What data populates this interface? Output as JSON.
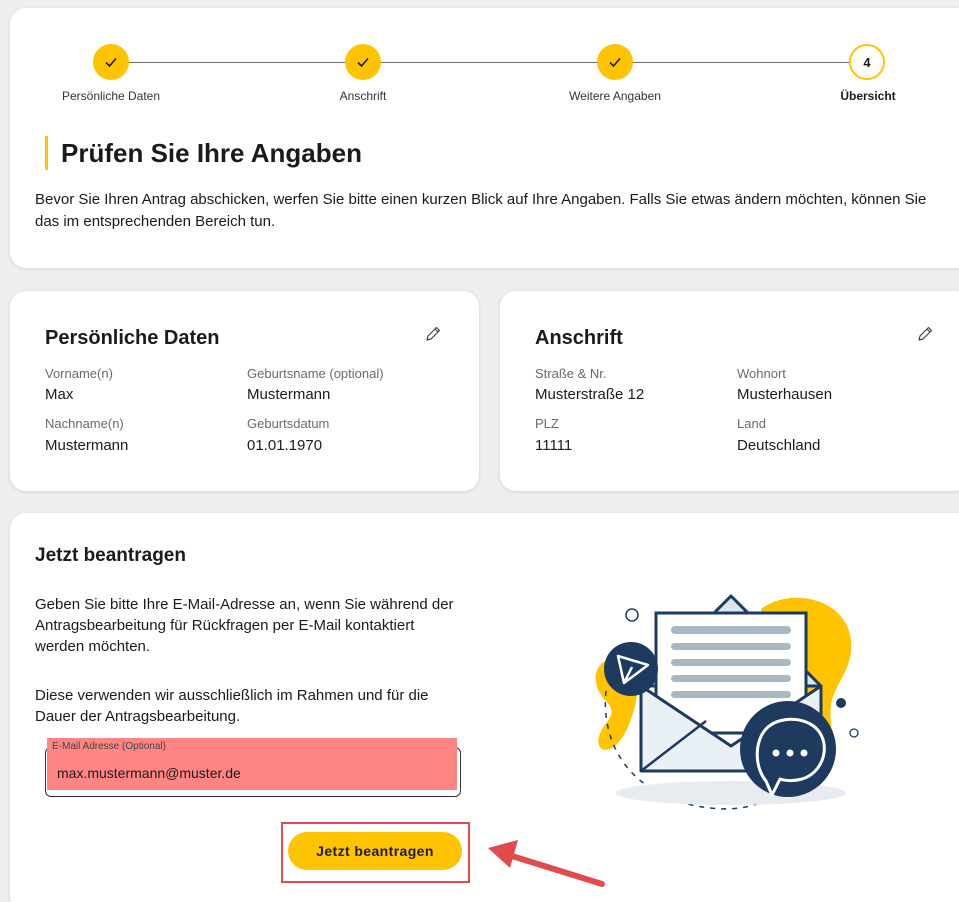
{
  "stepper": {
    "steps": [
      {
        "label": "Persönliche Daten",
        "status": "done"
      },
      {
        "label": "Anschrift",
        "status": "done"
      },
      {
        "label": "Weitere Angaben",
        "status": "done"
      },
      {
        "label": "Übersicht",
        "status": "active",
        "number": "4"
      }
    ]
  },
  "header": {
    "title": "Prüfen Sie Ihre Angaben",
    "intro": "Bevor Sie Ihren Antrag abschicken, werfen Sie bitte einen kurzen Blick auf Ihre Angaben. Falls Sie etwas ändern möchten, können Sie das im entsprechenden Bereich tun."
  },
  "personal": {
    "title": "Persönliche Daten",
    "fields": {
      "vorname": {
        "label": "Vorname(n)",
        "value": "Max"
      },
      "geburtsname": {
        "label": "Geburtsname (optional)",
        "value": "Mustermann"
      },
      "nachname": {
        "label": "Nachname(n)",
        "value": "Mustermann"
      },
      "geburtsdatum": {
        "label": "Geburtsdatum",
        "value": "01.01.1970"
      }
    }
  },
  "address": {
    "title": "Anschrift",
    "fields": {
      "strasse": {
        "label": "Straße & Nr.",
        "value": "Musterstraße 12"
      },
      "wohnort": {
        "label": "Wohnort",
        "value": "Musterhausen"
      },
      "plz": {
        "label": "PLZ",
        "value": "11111"
      },
      "land": {
        "label": "Land",
        "value": "Deutschland"
      }
    }
  },
  "apply": {
    "title": "Jetzt beantragen",
    "text1": "Geben Sie bitte Ihre E-Mail-Adresse an, wenn Sie während der Antragsbearbeitung für Rückfragen per E-Mail kontaktiert werden möchten.",
    "text2": "Diese verwenden wir ausschließlich im Rahmen und für die Dauer der Antragsbearbeitung.",
    "email_label": "E-Mail Adresse (Optional)",
    "email_value": "max.mustermann@muster.de",
    "submit_label": "Jetzt beantragen"
  },
  "colors": {
    "accent": "#ffc300",
    "navy": "#1e3a5f",
    "highlight": "#ff8585",
    "annotation": "#e24b4b"
  },
  "icons": {
    "step_done": "check-icon",
    "edit": "pencil-icon",
    "illustration": "envelope-illustration",
    "annotation": "red-arrow"
  }
}
